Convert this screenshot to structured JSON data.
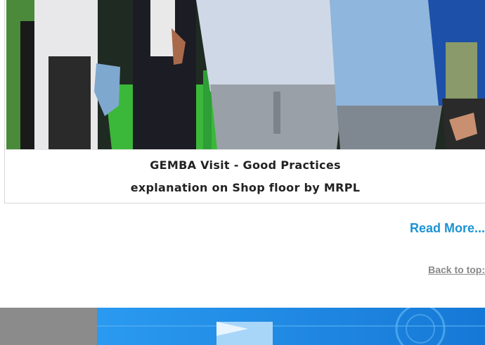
{
  "article": {
    "caption_line1": "GEMBA Visit - Good Practices",
    "caption_line2": "explanation on Shop floor by MRPL"
  },
  "links": {
    "read_more": "Read More...",
    "back_to_top": "Back to top:"
  },
  "colors": {
    "link_blue": "#1b93d3",
    "muted_link": "#888888",
    "banner_grey": "#8b8b8b",
    "banner_blue": "#1e8fe6"
  }
}
